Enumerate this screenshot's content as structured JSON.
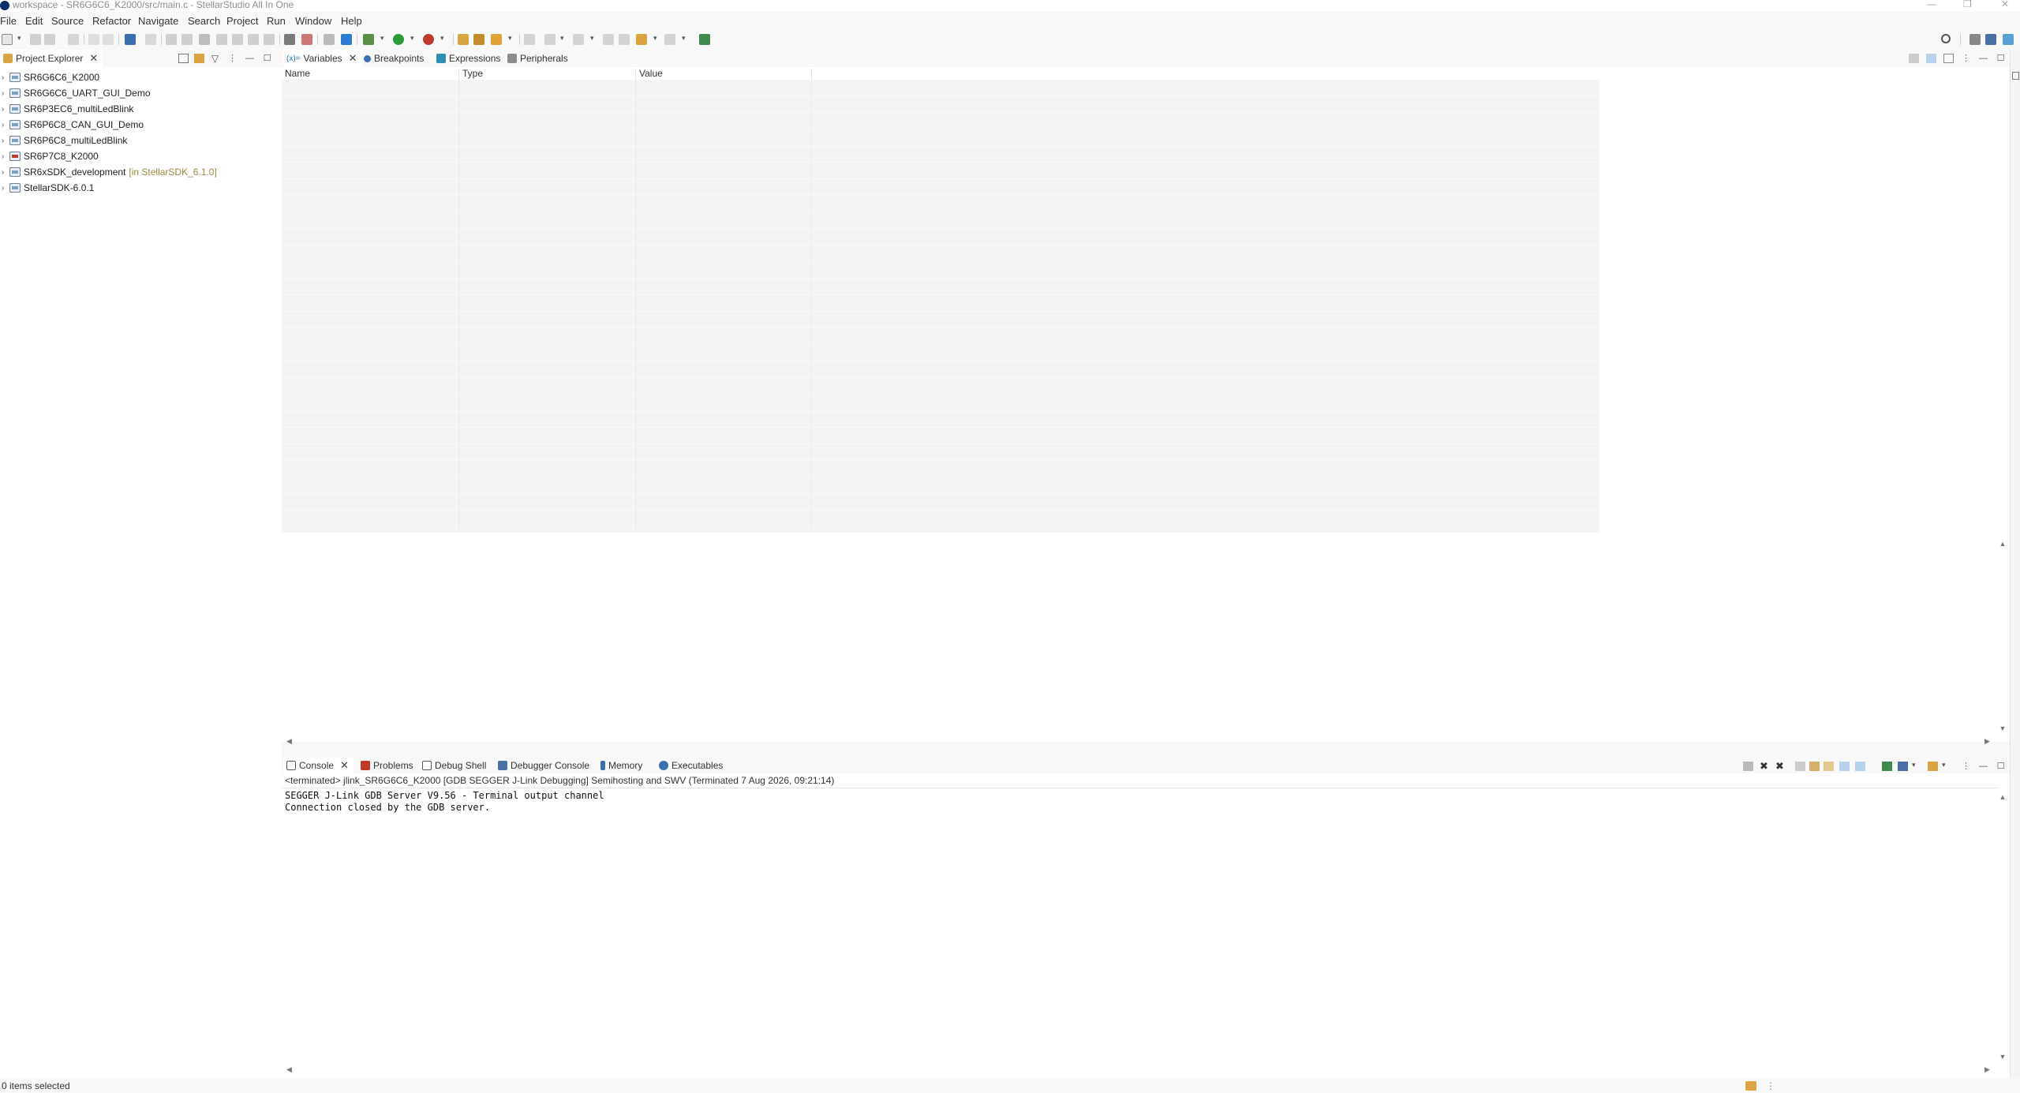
{
  "window": {
    "title": "workspace - SR6G6C6_K2000/src/main.c - StellarStudio All In One",
    "controls": [
      "—",
      "❐",
      "✕"
    ]
  },
  "menu": [
    "File",
    "Edit",
    "Source",
    "Refactor",
    "Navigate",
    "Search",
    "Project",
    "Run",
    "Window",
    "Help"
  ],
  "explorer": {
    "tab_label": "Project Explorer",
    "close": "✕",
    "items": [
      {
        "label": "SR6G6C6_K2000",
        "decoration": ""
      },
      {
        "label": "SR6G6C6_UART_GUI_Demo",
        "decoration": ""
      },
      {
        "label": "SR6P3EC6_multiLedBlink",
        "decoration": ""
      },
      {
        "label": "SR6P6C8_CAN_GUI_Demo",
        "decoration": ""
      },
      {
        "label": "SR6P6C8_multiLedBlink",
        "decoration": ""
      },
      {
        "label": "SR6P7C8_K2000",
        "decoration": ""
      },
      {
        "label": "SR6xSDK_development",
        "decoration": "[in StellarSDK_6.1.0]"
      },
      {
        "label": "StellarSDK-6.0.1",
        "decoration": ""
      }
    ]
  },
  "debug_views": {
    "tabs": [
      {
        "label": "Variables",
        "prefix": "(x)=",
        "close": "✕"
      },
      {
        "label": "Breakpoints"
      },
      {
        "label": "Expressions"
      },
      {
        "label": "Peripherals"
      }
    ],
    "columns": [
      "Name",
      "Type",
      "Value"
    ]
  },
  "console": {
    "tabs": [
      {
        "label": "Console",
        "close": "✕"
      },
      {
        "label": "Problems"
      },
      {
        "label": "Debug Shell"
      },
      {
        "label": "Debugger Console"
      },
      {
        "label": "Memory"
      },
      {
        "label": "Executables"
      }
    ],
    "process": "<terminated> jlink_SR6G6C6_K2000 [GDB SEGGER J-Link Debugging] Semihosting and SWV (Terminated 7 Aug 2026, 09:21:14)",
    "lines": [
      "SEGGER J-Link GDB Server V9.56 - Terminal output channel",
      "Connection closed by the GDB server."
    ]
  },
  "status": {
    "text": "0 items selected"
  },
  "icons": {
    "expand": "›",
    "up": "▲",
    "down": "▼",
    "left": "◀",
    "right": "▶",
    "dropdown": "▾",
    "kebab": "⋮",
    "minimize": "—",
    "maximize": "☐"
  },
  "colors": {
    "accent": "#1a73c8",
    "run_green": "#2e9b3a",
    "debug_red": "#c0392b",
    "decoration": "#9a8a3b"
  }
}
